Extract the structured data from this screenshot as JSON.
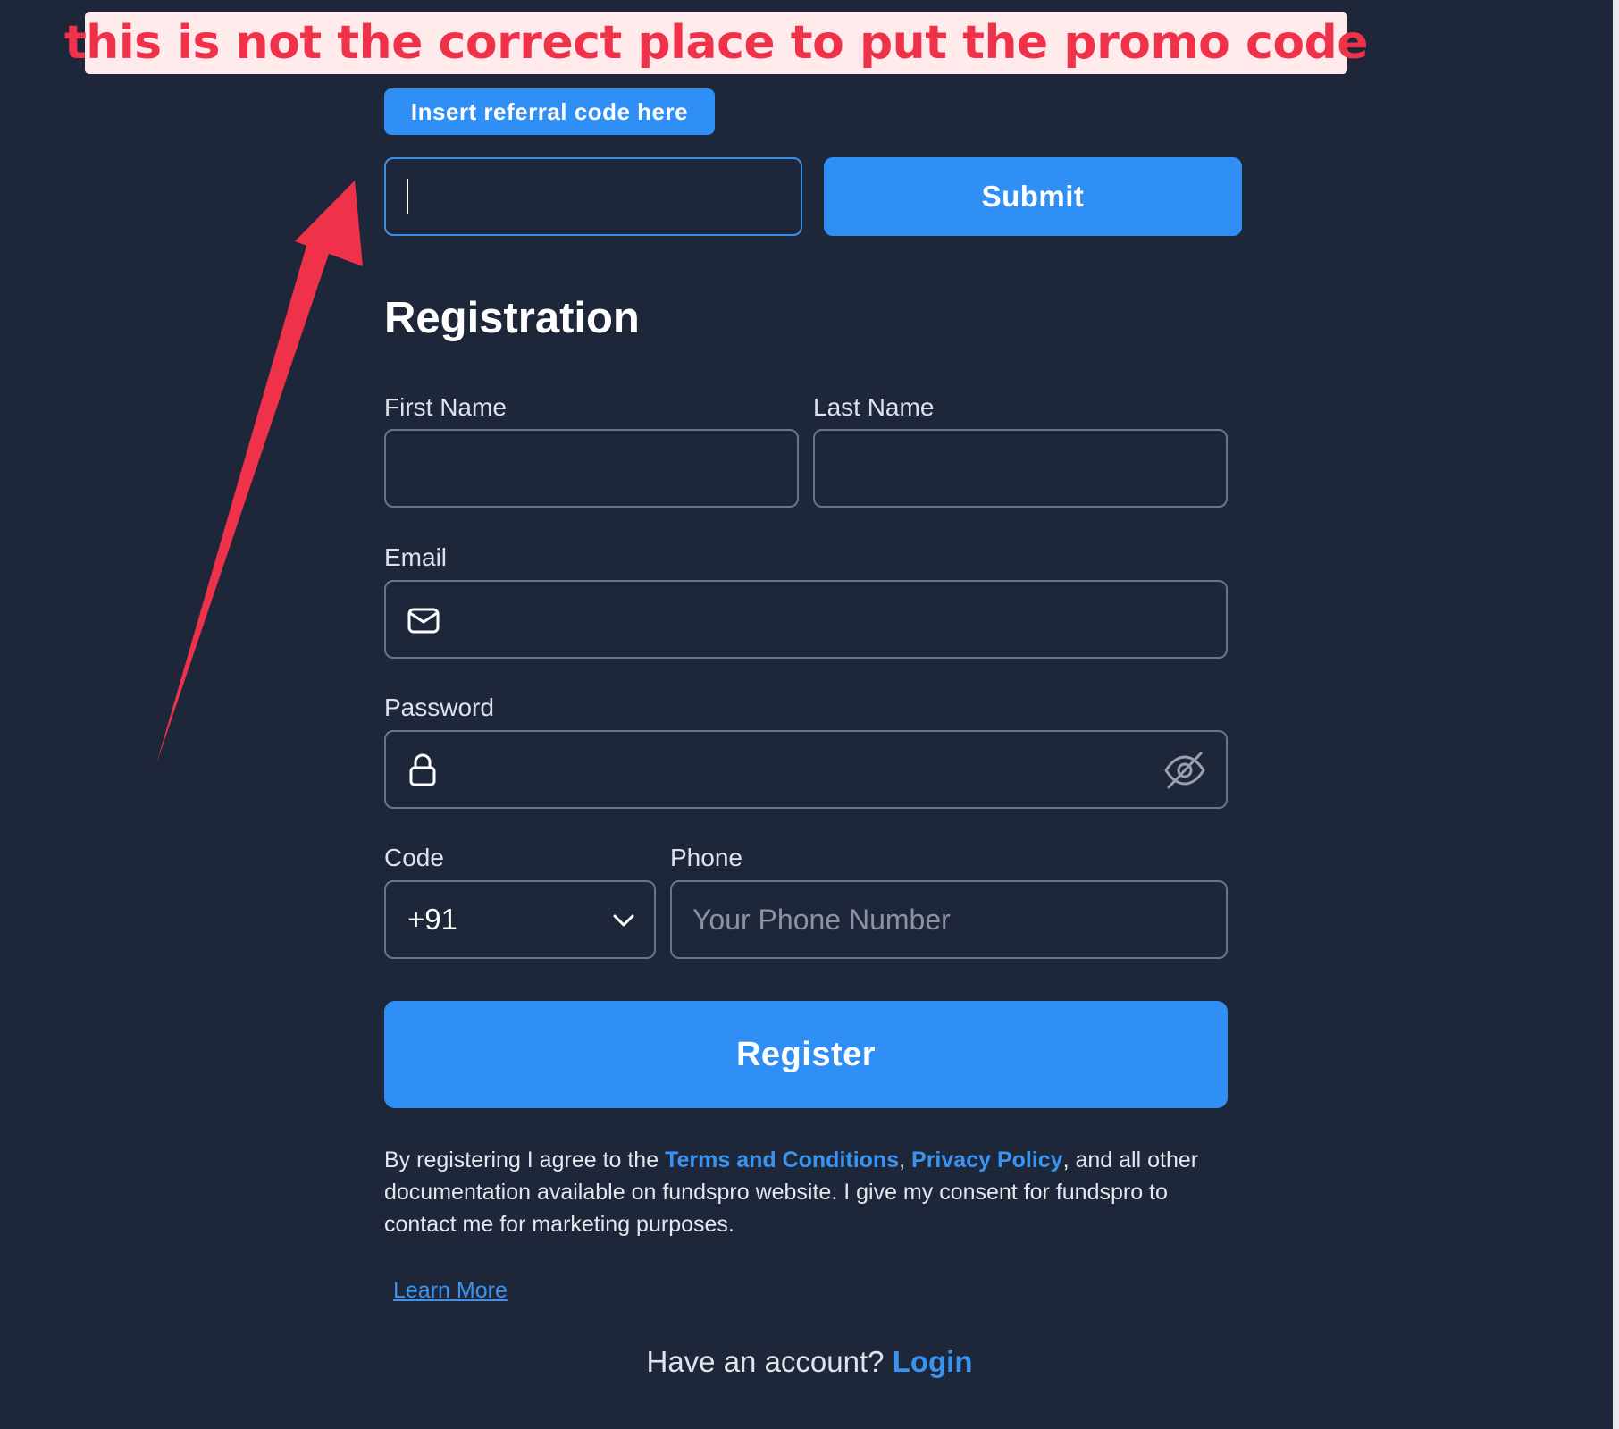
{
  "annotation": {
    "text": "this is not the correct place to put the promo code",
    "color": "#f0314a"
  },
  "referral": {
    "badge_label": "Insert referral code here",
    "input_value": "",
    "submit_label": "Submit"
  },
  "form": {
    "title": "Registration",
    "first_name_label": "First Name",
    "last_name_label": "Last Name",
    "email_label": "Email",
    "password_label": "Password",
    "code_label": "Code",
    "code_value": "+91",
    "phone_label": "Phone",
    "phone_placeholder": "Your Phone Number",
    "register_label": "Register"
  },
  "consent": {
    "prefix": "By registering I agree to the ",
    "terms_link": "Terms and Conditions",
    "comma": ", ",
    "privacy_link": "Privacy Policy",
    "suffix": ", and all other documentation available on fundspro website. I give my consent for fundspro to contact me for marketing purposes."
  },
  "learn_more": "Learn More",
  "login": {
    "prompt": "Have an account? ",
    "link": "Login"
  },
  "colors": {
    "background": "#1d2739",
    "accent": "#2f8ff5",
    "link": "#3a93f0",
    "border": "#6b7485"
  },
  "icons": {
    "email": "mail-icon",
    "password": "lock-icon",
    "visibility": "eye-off-icon",
    "dropdown": "chevron-down-icon"
  }
}
